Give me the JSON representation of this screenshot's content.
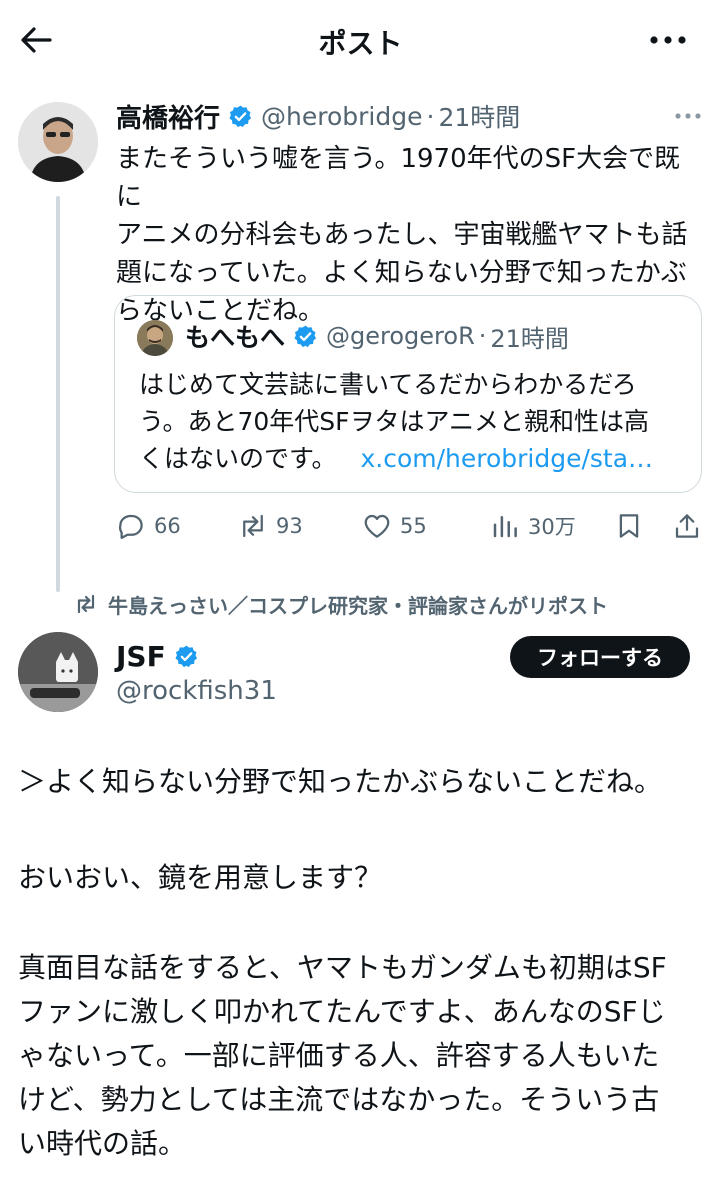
{
  "header": {
    "title": "ポスト"
  },
  "tweet1": {
    "author_name": "高橋裕行",
    "handle": "@herobridge",
    "separator": "·",
    "time": "21時間",
    "lines": [
      "またそういう嘘を言う。1970年代のSF大会で既に",
      "アニメの分科会もあったし、宇宙戦艦ヤマトも話",
      "題になっていた。よく知らない分野で知ったかぶ",
      "らないことだね。"
    ],
    "quote": {
      "author_name": "もへもへ",
      "handle": "@gerogeroR",
      "separator": "·",
      "time": "21時間",
      "lines": [
        "はじめて文芸誌に書いてるだからわかるだろ",
        "う。あと70年代SFヲタはアニメと親和性は高"
      ],
      "last_line_text": "くはないのです。",
      "link_text": "x.com/herobridge/sta…"
    },
    "actions": {
      "replies": "66",
      "reposts": "93",
      "likes": "55",
      "views": "30万"
    }
  },
  "repost_banner": "牛島えっさい／コスプレ研究家・評論家さんがリポスト",
  "tweet2": {
    "author_name": "JSF",
    "handle": "@rockfish31",
    "follow_label": "フォローする",
    "paragraphs": [
      "＞よく知らない分野で知ったかぶらないことだね。",
      "おいおい、鏡を用意します？",
      "真面目な話をすると、ヤマトもガンダムも初期はSF\nファンに激しく叩かれてたんですよ、あんなのSFじ\nゃないって。一部に評価する人、許容する人もいた\nけど、勢力としては主流ではなかった。そういう古\nい時代の話。"
    ]
  },
  "colors": {
    "text": "#0f1419",
    "secondary": "#536471",
    "link": "#1d9bf0",
    "verified": "#1d9bf0",
    "border": "#cfd9de",
    "button_bg": "#0f1419"
  },
  "icons": [
    "back-arrow-icon",
    "more-icon",
    "verified-badge-icon",
    "reply-icon",
    "repost-icon",
    "like-icon",
    "views-icon",
    "bookmark-icon",
    "share-icon"
  ]
}
